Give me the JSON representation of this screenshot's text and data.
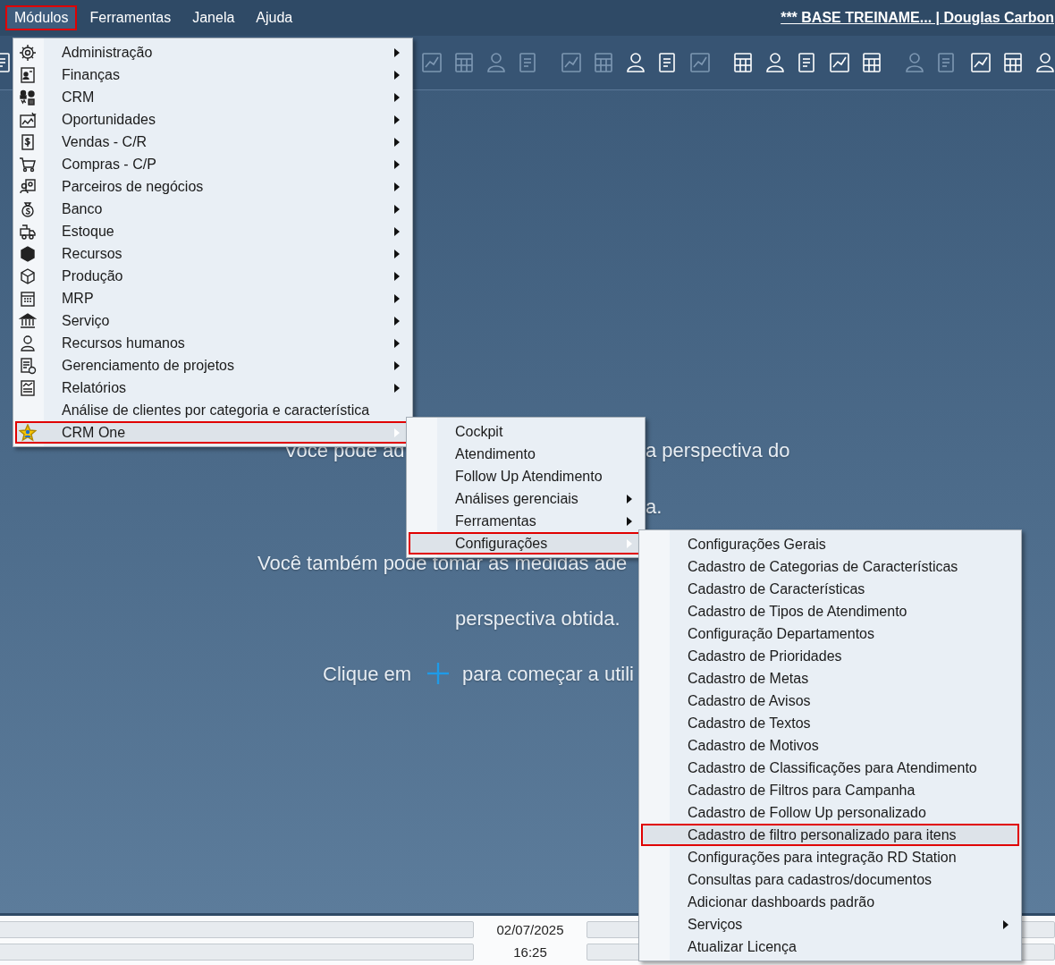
{
  "menubar": {
    "items": [
      {
        "label": "Módulos",
        "selected": true
      },
      {
        "label": "Ferramentas",
        "selected": false
      },
      {
        "label": "Janela",
        "selected": false
      },
      {
        "label": "Ajuda",
        "selected": false
      }
    ],
    "title": "*** BASE TREINAME... | Douglas Carbon"
  },
  "toolbar": {
    "groups": [
      [
        {
          "disabled": false
        }
      ],
      [
        {
          "disabled": true
        },
        {
          "disabled": true
        },
        {
          "disabled": true
        },
        {
          "disabled": true
        }
      ],
      [
        {
          "disabled": true
        },
        {
          "disabled": true
        },
        {
          "disabled": false
        },
        {
          "disabled": false
        },
        {
          "disabled": true
        }
      ],
      [
        {
          "disabled": false
        },
        {
          "disabled": false
        },
        {
          "disabled": false
        },
        {
          "disabled": false
        },
        {
          "disabled": false
        }
      ],
      [
        {
          "disabled": true
        },
        {
          "disabled": true
        }
      ],
      [
        {
          "disabled": false
        },
        {
          "disabled": false
        },
        {
          "disabled": false
        }
      ]
    ]
  },
  "background_text": [
    "Você pode ad",
    "a perspectiva do",
    "a.",
    "Você também pode tomar as medidas ade",
    "perspectiva obtida.",
    "Clique em",
    "para começar a utili"
  ],
  "menus": [
    {
      "items": [
        {
          "label": "Administração",
          "submenu": true,
          "selected": false
        },
        {
          "label": "Finanças",
          "submenu": true,
          "selected": false
        },
        {
          "label": "CRM",
          "submenu": true,
          "selected": false
        },
        {
          "label": "Oportunidades",
          "submenu": true,
          "selected": false
        },
        {
          "label": "Vendas - C/R",
          "submenu": true,
          "selected": false
        },
        {
          "label": "Compras - C/P",
          "submenu": true,
          "selected": false
        },
        {
          "label": "Parceiros de negócios",
          "submenu": true,
          "selected": false
        },
        {
          "label": "Banco",
          "submenu": true,
          "selected": false
        },
        {
          "label": "Estoque",
          "submenu": true,
          "selected": false
        },
        {
          "label": "Recursos",
          "submenu": true,
          "selected": false
        },
        {
          "label": "Produção",
          "submenu": true,
          "selected": false
        },
        {
          "label": "MRP",
          "submenu": true,
          "selected": false
        },
        {
          "label": "Serviço",
          "submenu": true,
          "selected": false
        },
        {
          "label": "Recursos humanos",
          "submenu": true,
          "selected": false
        },
        {
          "label": "Gerenciamento de projetos",
          "submenu": true,
          "selected": false
        },
        {
          "label": "Relatórios",
          "submenu": true,
          "selected": false
        },
        {
          "label": "Análise de clientes por categoria e característica",
          "submenu": false,
          "selected": false
        },
        {
          "label": "CRM One",
          "submenu": true,
          "selected": true
        }
      ]
    },
    {
      "items": [
        {
          "label": "Cockpit",
          "submenu": false,
          "selected": false
        },
        {
          "label": "Atendimento",
          "submenu": false,
          "selected": false
        },
        {
          "label": "Follow Up Atendimento",
          "submenu": false,
          "selected": false
        },
        {
          "label": "Análises gerenciais",
          "submenu": true,
          "selected": false
        },
        {
          "label": "Ferramentas",
          "submenu": true,
          "selected": false
        },
        {
          "label": "Configurações",
          "submenu": true,
          "selected": true
        }
      ]
    },
    {
      "items": [
        {
          "label": "Configurações Gerais",
          "submenu": false,
          "selected": false
        },
        {
          "label": "Cadastro de Categorias de Características",
          "submenu": false,
          "selected": false
        },
        {
          "label": "Cadastro de Características",
          "submenu": false,
          "selected": false
        },
        {
          "label": "Cadastro de Tipos de Atendimento",
          "submenu": false,
          "selected": false
        },
        {
          "label": "Configuração Departamentos",
          "submenu": false,
          "selected": false
        },
        {
          "label": "Cadastro de Prioridades",
          "submenu": false,
          "selected": false
        },
        {
          "label": "Cadastro de Metas",
          "submenu": false,
          "selected": false
        },
        {
          "label": "Cadastro de Avisos",
          "submenu": false,
          "selected": false
        },
        {
          "label": "Cadastro de Textos",
          "submenu": false,
          "selected": false
        },
        {
          "label": "Cadastro de Motivos",
          "submenu": false,
          "selected": false
        },
        {
          "label": "Cadastro de Classificações para Atendimento",
          "submenu": false,
          "selected": false
        },
        {
          "label": "Cadastro de Filtros para Campanha",
          "submenu": false,
          "selected": false
        },
        {
          "label": "Cadastro de Follow Up personalizado",
          "submenu": false,
          "selected": false
        },
        {
          "label": "Cadastro de filtro personalizado para itens",
          "submenu": false,
          "selected": true
        },
        {
          "label": "Configurações para integração RD Station",
          "submenu": false,
          "selected": false
        },
        {
          "label": "Consultas para cadastros/documentos",
          "submenu": false,
          "selected": false
        },
        {
          "label": "Adicionar dashboards padrão",
          "submenu": false,
          "selected": false
        },
        {
          "label": "Serviços",
          "submenu": true,
          "selected": false
        },
        {
          "label": "Atualizar Licença",
          "submenu": false,
          "selected": false
        }
      ]
    }
  ],
  "status_bar": {
    "date": "02/07/2025",
    "time": "16:25"
  }
}
